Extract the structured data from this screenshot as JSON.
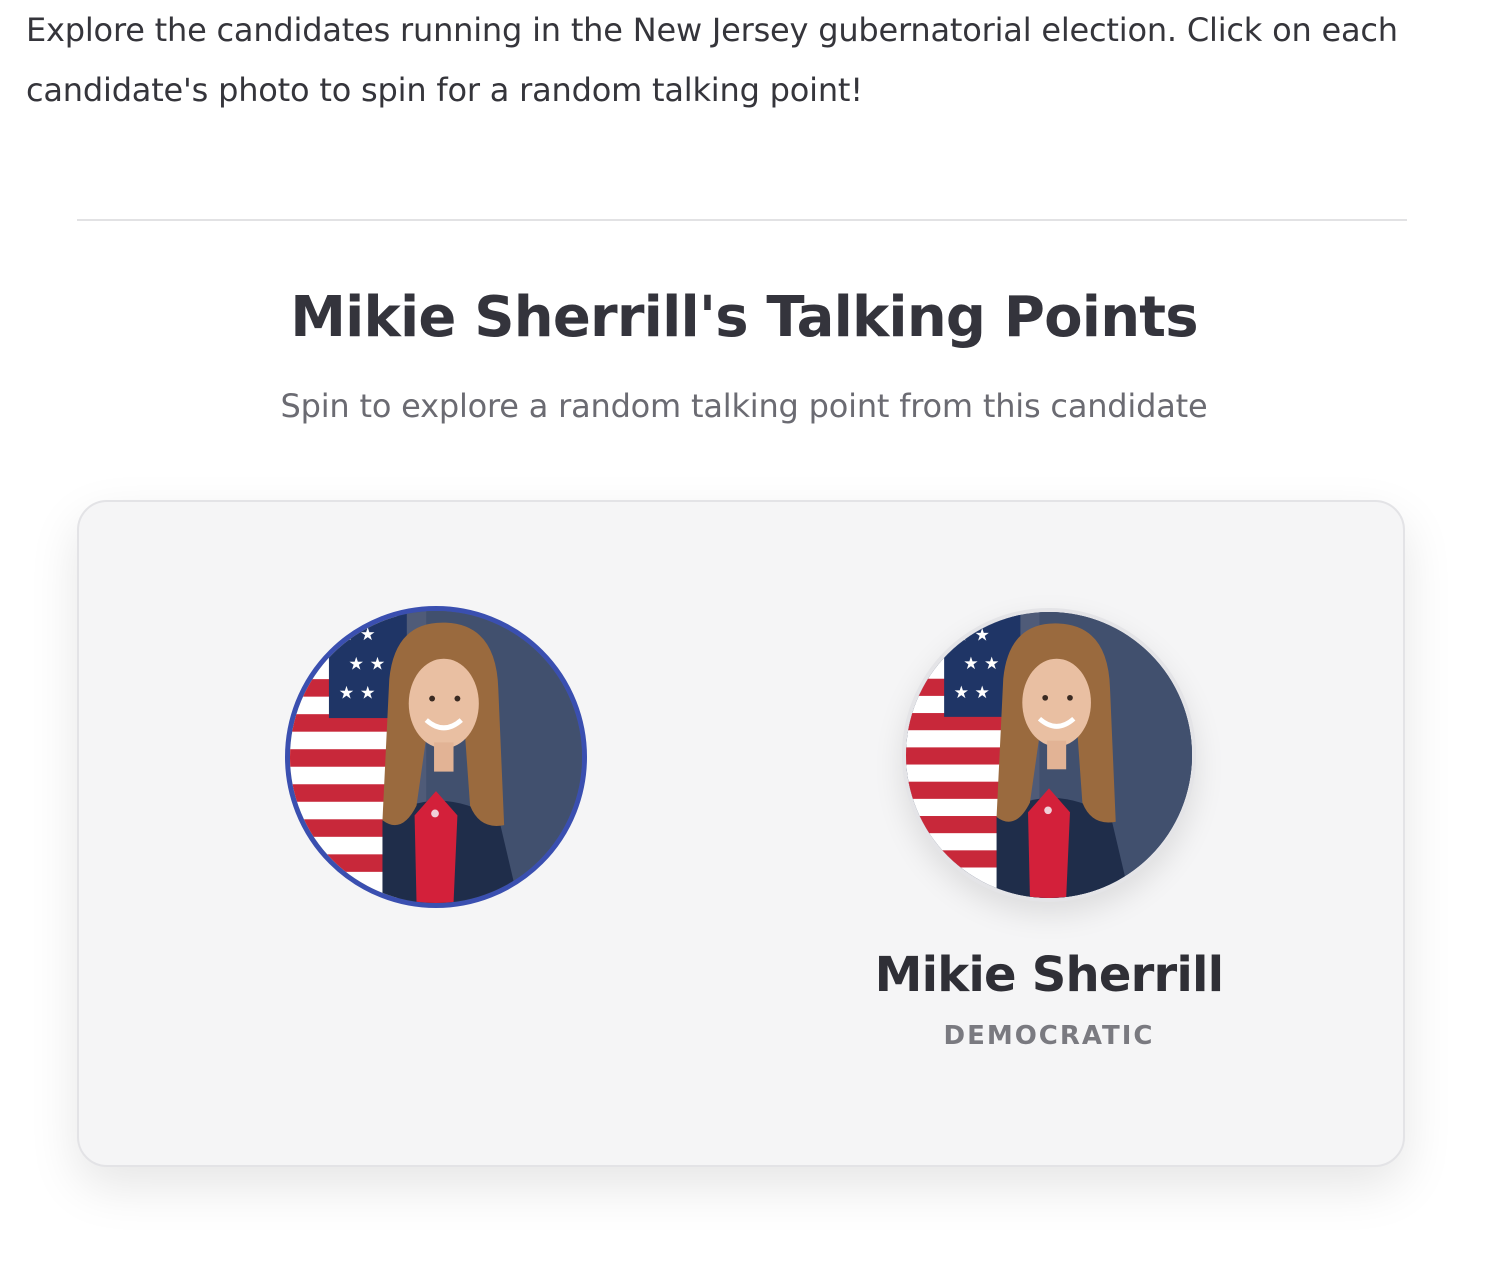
{
  "intro": {
    "text": "Explore the candidates running in the New Jersey gubernatorial election. Click on each candidate's photo to spin for a random talking point!"
  },
  "section": {
    "title": "Mikie Sherrill's Talking Points",
    "subtitle": "Spin to explore a random talking point from this candidate"
  },
  "candidate": {
    "name": "Mikie Sherrill",
    "party": "DEMOCRATIC",
    "photo_icon": "candidate-portrait-icon"
  },
  "colors": {
    "spinner_ring": "#3a4fb0",
    "card_background": "#f5f5f6",
    "blazer": "#1f2d4a",
    "shirt": "#d3203a",
    "backdrop": "#4a5670"
  }
}
